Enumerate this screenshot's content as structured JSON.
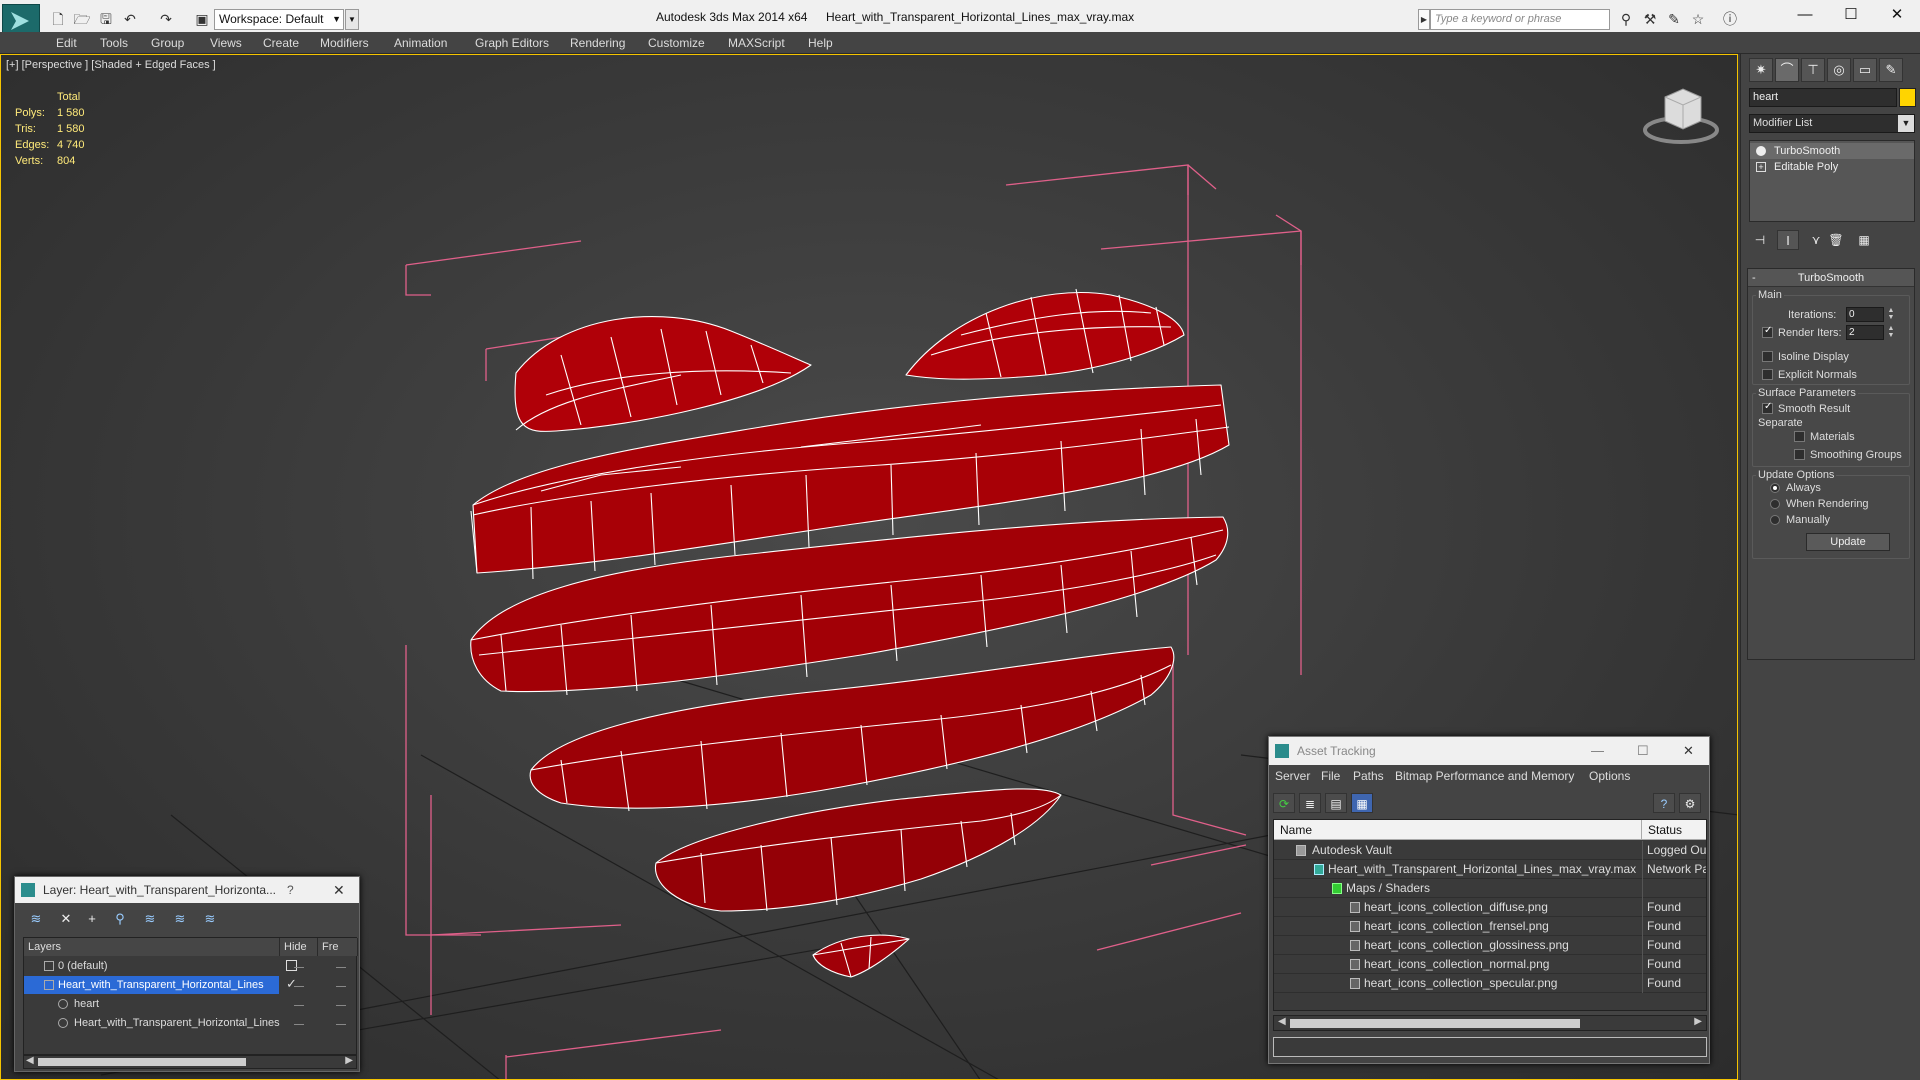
{
  "titlebar": {
    "workspace": "Workspace: Default",
    "app_title": "Autodesk 3ds Max  2014 x64",
    "file_title": "Heart_with_Transparent_Horizontal_Lines_max_vray.max",
    "search_placeholder": "Type a keyword or phrase"
  },
  "menu": [
    "Edit",
    "Tools",
    "Group",
    "Views",
    "Create",
    "Modifiers",
    "Animation",
    "Graph Editors",
    "Rendering",
    "Customize",
    "MAXScript",
    "Help"
  ],
  "viewport": {
    "label": "[+] [Perspective ] [Shaded + Edged Faces ]",
    "stats": {
      "total_label": "Total",
      "rows": [
        {
          "label": "Polys:",
          "value": "1 580"
        },
        {
          "label": "Tris:",
          "value": "1 580"
        },
        {
          "label": "Edges:",
          "value": "4 740"
        },
        {
          "label": "Verts:",
          "value": "804"
        }
      ]
    },
    "object_color": "#c0060c",
    "edge_color": "#ffffff",
    "bbox_color": "#e0608a"
  },
  "command_panel": {
    "object_name": "heart",
    "modifier_list": "Modifier List",
    "stack": [
      "TurboSmooth",
      "Editable Poly"
    ],
    "rollout": {
      "title": "TurboSmooth",
      "main_label": "Main",
      "iterations_label": "Iterations:",
      "iterations_value": "0",
      "render_iters_label": "Render Iters:",
      "render_iters_value": "2",
      "isoline_label": "Isoline Display",
      "explicit_normals_label": "Explicit Normals",
      "surface_params_label": "Surface Parameters",
      "smooth_result_label": "Smooth Result",
      "separate_label": "Separate",
      "materials_label": "Materials",
      "smoothing_groups_label": "Smoothing Groups",
      "update_options_label": "Update Options",
      "always_label": "Always",
      "when_rendering_label": "When Rendering",
      "manually_label": "Manually",
      "update_button": "Update"
    }
  },
  "layer_window": {
    "title": "Layer: Heart_with_Transparent_Horizonta...",
    "help": "?",
    "col_layers": "Layers",
    "col_hide": "Hide",
    "col_freeze": "Fre",
    "rows": [
      {
        "name": "0 (default)"
      },
      {
        "name": "Heart_with_Transparent_Horizontal_Lines"
      },
      {
        "name": "heart"
      },
      {
        "name": "Heart_with_Transparent_Horizontal_Lines"
      }
    ]
  },
  "asset_tracking": {
    "title": "Asset Tracking",
    "menu": [
      "Server",
      "File",
      "Paths",
      "Bitmap Performance and Memory",
      "Options"
    ],
    "col_name": "Name",
    "col_status": "Status",
    "rows": [
      {
        "name": "Autodesk Vault",
        "status": "Logged Out"
      },
      {
        "name": "Heart_with_Transparent_Horizontal_Lines_max_vray.max",
        "status": "Network Pa"
      },
      {
        "name": "Maps / Shaders",
        "status": ""
      },
      {
        "name": "heart_icons_collection_diffuse.png",
        "status": "Found"
      },
      {
        "name": "heart_icons_collection_frensel.png",
        "status": "Found"
      },
      {
        "name": "heart_icons_collection_glossiness.png",
        "status": "Found"
      },
      {
        "name": "heart_icons_collection_normal.png",
        "status": "Found"
      },
      {
        "name": "heart_icons_collection_specular.png",
        "status": "Found"
      }
    ]
  }
}
